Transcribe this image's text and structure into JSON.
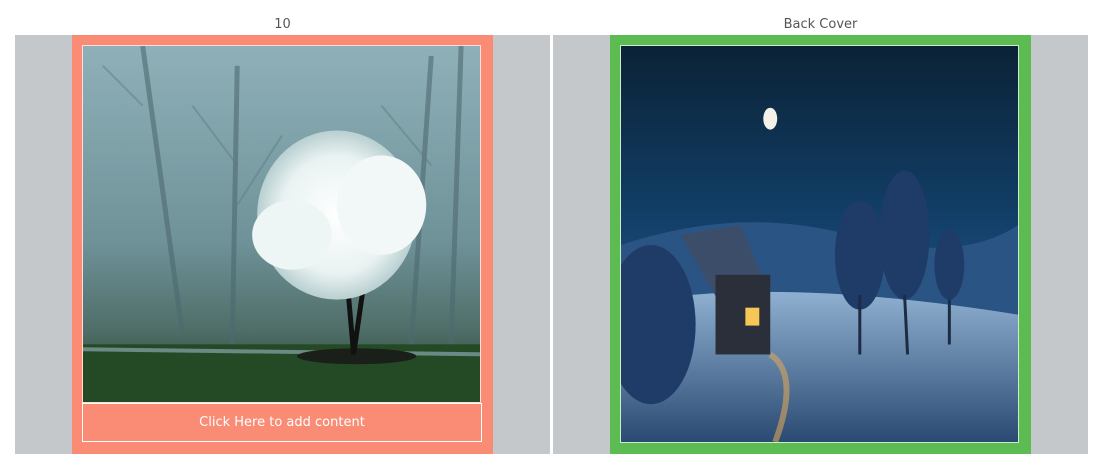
{
  "pages": {
    "left": {
      "label": "10",
      "add_content_label": "Click Here to add content",
      "frame_color": "#fa8c76"
    },
    "right": {
      "label": "Back Cover",
      "frame_color": "#5cbb51"
    }
  }
}
